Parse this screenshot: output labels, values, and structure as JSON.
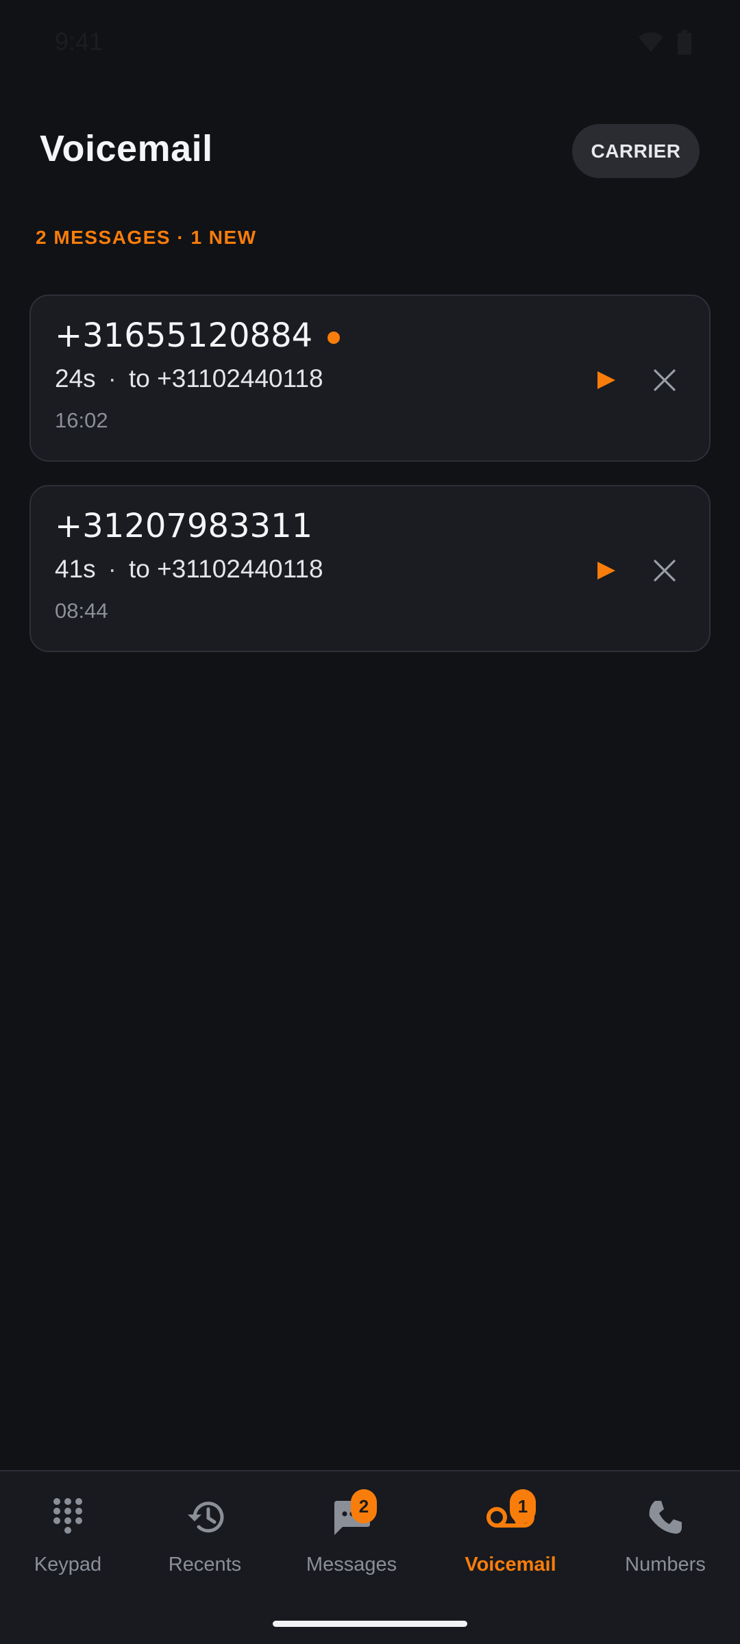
{
  "status": {
    "time": "9:41"
  },
  "header": {
    "title": "Voicemail",
    "carrier_label": "CARRIER"
  },
  "summary": "2 MESSAGES · 1 NEW",
  "voicemails": [
    {
      "number": "+31655120884",
      "duration": "24s",
      "separator": "·",
      "to": "to +31102440118",
      "time": "16:02",
      "is_new": true
    },
    {
      "number": "+31207983311",
      "duration": "41s",
      "separator": "·",
      "to": "to +31102440118",
      "time": "08:44",
      "is_new": false
    }
  ],
  "nav": {
    "items": [
      {
        "label": "Keypad",
        "icon": "keypad-icon"
      },
      {
        "label": "Recents",
        "icon": "history-icon"
      },
      {
        "label": "Messages",
        "icon": "chat-icon",
        "badge": "2"
      },
      {
        "label": "Voicemail",
        "icon": "voicemail-icon",
        "badge": "1",
        "active": true
      },
      {
        "label": "Numbers",
        "icon": "phone-icon"
      }
    ]
  },
  "colors": {
    "accent": "#f97d0b",
    "background": "#111216",
    "card": "#1a1c22",
    "muted": "#8b8f98"
  }
}
